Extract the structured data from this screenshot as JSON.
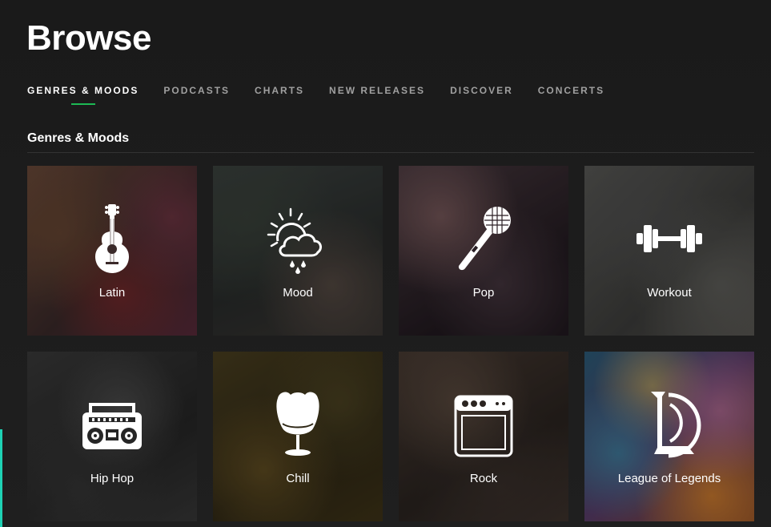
{
  "page": {
    "title": "Browse"
  },
  "tabs": [
    {
      "label": "GENRES & MOODS",
      "active": true
    },
    {
      "label": "PODCASTS",
      "active": false
    },
    {
      "label": "CHARTS",
      "active": false
    },
    {
      "label": "NEW RELEASES",
      "active": false
    },
    {
      "label": "DISCOVER",
      "active": false
    },
    {
      "label": "CONCERTS",
      "active": false
    }
  ],
  "section": {
    "title": "Genres & Moods"
  },
  "cards": [
    {
      "label": "Latin",
      "icon": "guitar-icon"
    },
    {
      "label": "Mood",
      "icon": "sun-cloud-rain-icon"
    },
    {
      "label": "Pop",
      "icon": "microphone-icon"
    },
    {
      "label": "Workout",
      "icon": "dumbbell-icon"
    },
    {
      "label": "Hip Hop",
      "icon": "boombox-icon"
    },
    {
      "label": "Chill",
      "icon": "egg-chair-icon"
    },
    {
      "label": "Rock",
      "icon": "amplifier-icon"
    },
    {
      "label": "League of Legends",
      "icon": "league-of-legends-logo-icon"
    }
  ],
  "colors": {
    "background": "#1c1c1c",
    "tab_active_underline": "#1db954",
    "tab_inactive_text": "#a0a0a0",
    "left_accent": "#1ed2b4"
  }
}
